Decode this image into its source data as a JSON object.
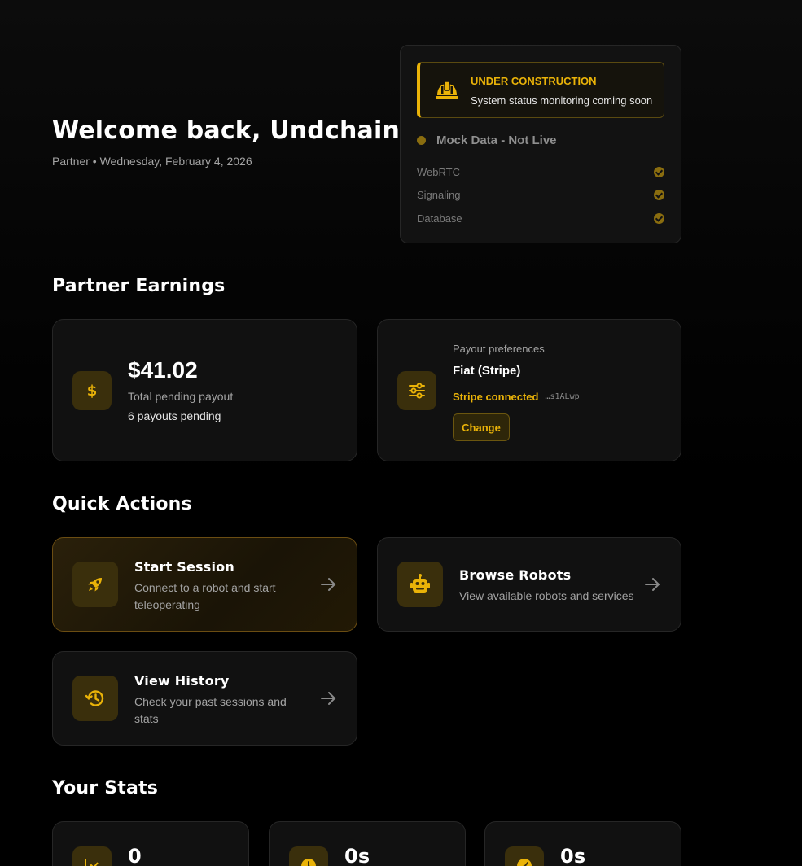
{
  "header": {
    "welcome": "Welcome back, Undchain!",
    "subtitle": "Partner • Wednesday, February 4, 2026"
  },
  "status_panel": {
    "construction_title": "UNDER CONSTRUCTION",
    "construction_text": "System status monitoring coming soon",
    "mock_label": "Mock Data - Not Live",
    "services": [
      {
        "name": "WebRTC",
        "icon": "check-circle-icon"
      },
      {
        "name": "Signaling",
        "icon": "check-circle-icon"
      },
      {
        "name": "Database",
        "icon": "check-circle-icon"
      }
    ]
  },
  "earnings": {
    "section_title": "Partner Earnings",
    "amount": "$41.02",
    "amount_label": "Total pending payout",
    "pending": "6 payouts pending",
    "pref_label": "Payout preferences",
    "pref_value": "Fiat (Stripe)",
    "stripe_status": "Stripe connected",
    "stripe_id": "…s1ALwp",
    "change_label": "Change"
  },
  "quick_actions": {
    "section_title": "Quick Actions",
    "items": [
      {
        "title": "Start Session",
        "desc": "Connect to a robot and start teleoperating",
        "icon": "rocket-icon"
      },
      {
        "title": "Browse Robots",
        "desc": "View available robots and services",
        "icon": "robot-icon"
      },
      {
        "title": "View History",
        "desc": "Check your past sessions and stats",
        "icon": "history-icon"
      }
    ]
  },
  "stats": {
    "section_title": "Your Stats",
    "items": [
      {
        "value": "0",
        "icon": "chart-icon"
      },
      {
        "value": "0s",
        "icon": "clock-icon"
      },
      {
        "value": "0s",
        "icon": "gauge-icon"
      }
    ]
  },
  "colors": {
    "accent": "#eab308",
    "background": "#000000",
    "card": "#111111"
  }
}
